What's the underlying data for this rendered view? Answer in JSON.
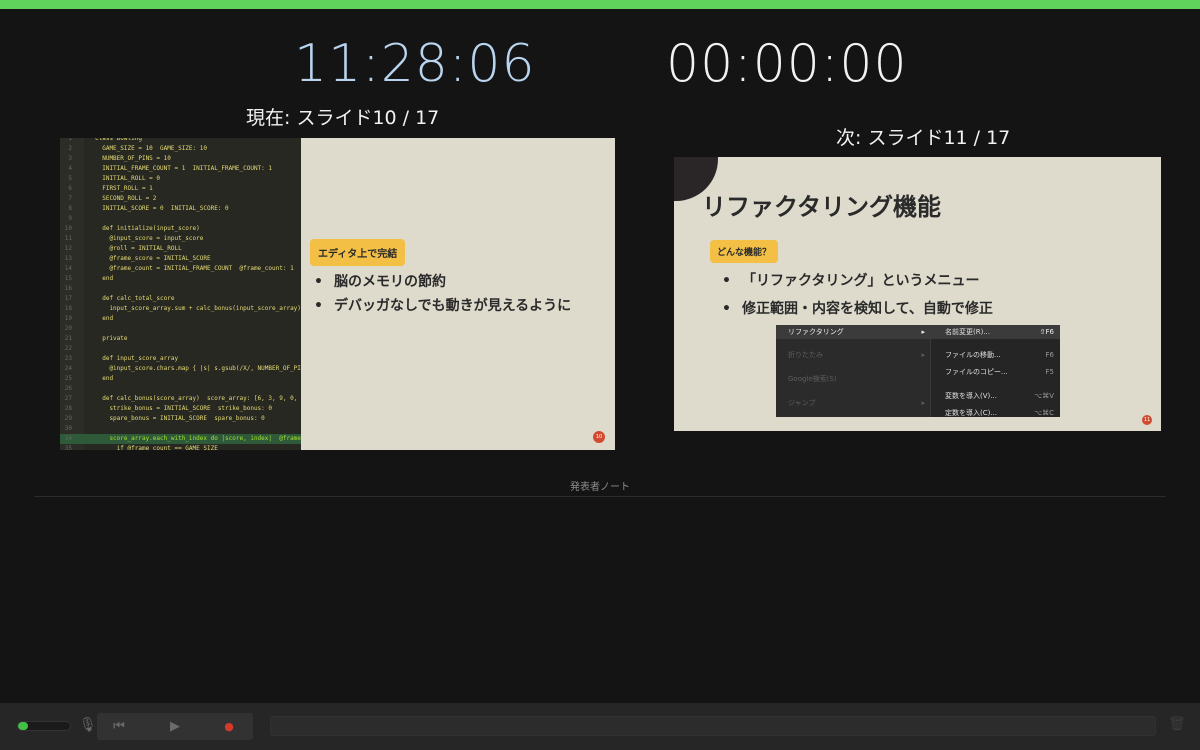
{
  "clocks": {
    "current_time": "11:28:06",
    "elapsed_time": "00:00:00"
  },
  "current_slide": {
    "label": "現在: スライド10 / 17",
    "badge": "エディタ上で完結",
    "bullets": [
      "脳のメモリの節約",
      "デバッガなしでも動きが見えるように"
    ],
    "page_number": "10",
    "code_lines": [
      {
        "ln": "1",
        "text": "class Bowling"
      },
      {
        "ln": "2",
        "text": "  GAME_SIZE = 10  GAME_SIZE: 10"
      },
      {
        "ln": "3",
        "text": "  NUMBER_OF_PINS = 10"
      },
      {
        "ln": "4",
        "text": "  INITIAL_FRAME_COUNT = 1  INITIAL_FRAME_COUNT: 1"
      },
      {
        "ln": "5",
        "text": "  INITIAL_ROLL = 0"
      },
      {
        "ln": "6",
        "text": "  FIRST_ROLL = 1"
      },
      {
        "ln": "7",
        "text": "  SECOND_ROLL = 2"
      },
      {
        "ln": "8",
        "text": "  INITIAL_SCORE = 0  INITIAL_SCORE: 0"
      },
      {
        "ln": "9",
        "text": ""
      },
      {
        "ln": "10",
        "text": "  def initialize(input_score)"
      },
      {
        "ln": "11",
        "text": "    @input_score = input_score"
      },
      {
        "ln": "12",
        "text": "    @roll = INITIAL_ROLL"
      },
      {
        "ln": "13",
        "text": "    @frame_score = INITIAL_SCORE"
      },
      {
        "ln": "14",
        "text": "    @frame_count = INITIAL_FRAME_COUNT  @frame_count: 1"
      },
      {
        "ln": "15",
        "text": "  end"
      },
      {
        "ln": "16",
        "text": ""
      },
      {
        "ln": "17",
        "text": "  def calc_total_score"
      },
      {
        "ln": "18",
        "text": "    input_score_array.sum + calc_bonus(input_score_array)"
      },
      {
        "ln": "19",
        "text": "  end"
      },
      {
        "ln": "20",
        "text": ""
      },
      {
        "ln": "21",
        "text": "  private"
      },
      {
        "ln": "22",
        "text": ""
      },
      {
        "ln": "23",
        "text": "  def input_score_array"
      },
      {
        "ln": "24",
        "text": "    @input_score.chars.map { |s| s.gsub(/X/, NUMBER_OF_PINS.to_s"
      },
      {
        "ln": "25",
        "text": "  end"
      },
      {
        "ln": "26",
        "text": ""
      },
      {
        "ln": "27",
        "text": "  def calc_bonus(score_array)  score_array: [6, 3, 9, 0, 0, 3, 8"
      },
      {
        "ln": "28",
        "text": "    strike_bonus = INITIAL_SCORE  strike_bonus: 0"
      },
      {
        "ln": "29",
        "text": "    spare_bonus = INITIAL_SCORE  spare_bonus: 0"
      },
      {
        "ln": "30",
        "text": ""
      },
      {
        "ln": "34",
        "text": "    score_array.each_with_index do |score, index|  @frame_count:"
      },
      {
        "ln": "35",
        "text": "      if @frame_count == GAME_SIZE"
      }
    ]
  },
  "next_slide": {
    "label": "次: スライド11 / 17",
    "title": "リファクタリング機能",
    "badge": "どんな機能？",
    "bullets": [
      "「リファクタリング」というメニュー",
      "修正範囲・内容を検知して、自動で修正"
    ],
    "page_number": "11",
    "menu_left": [
      {
        "label": "リファクタリング",
        "arrow": "▸"
      },
      {
        "label": "折りたたみ",
        "arrow": "▸"
      },
      {
        "label": "Google検索(S)",
        "arrow": ""
      },
      {
        "label": "ジャンプ",
        "arrow": "▸"
      }
    ],
    "menu_right": [
      {
        "label": "名前変更(R)...",
        "shortcut": "⇧F6"
      },
      {
        "label": "ファイルの移動...",
        "shortcut": "F6"
      },
      {
        "label": "ファイルのコピー...",
        "shortcut": "F5"
      },
      {
        "label": "変数を導入(V)...",
        "shortcut": "⌥⌘V"
      },
      {
        "label": "定数を導入(C)...",
        "shortcut": "⌥⌘C"
      }
    ]
  },
  "notes": {
    "label": "発表者ノート"
  },
  "controls": {
    "mic_level": 0.2,
    "mic_icon": "microphone-muted-icon",
    "prev_icon": "⏮",
    "play_icon": "▶",
    "record_icon": "●",
    "trash_icon": "🗑"
  },
  "colors": {
    "accent_green": "#5fd35b",
    "clock_blue": "#b8d4ee",
    "badge_yellow": "#f3bf45",
    "slide_bg": "#dedbcd",
    "record_red": "#d43a2a"
  }
}
